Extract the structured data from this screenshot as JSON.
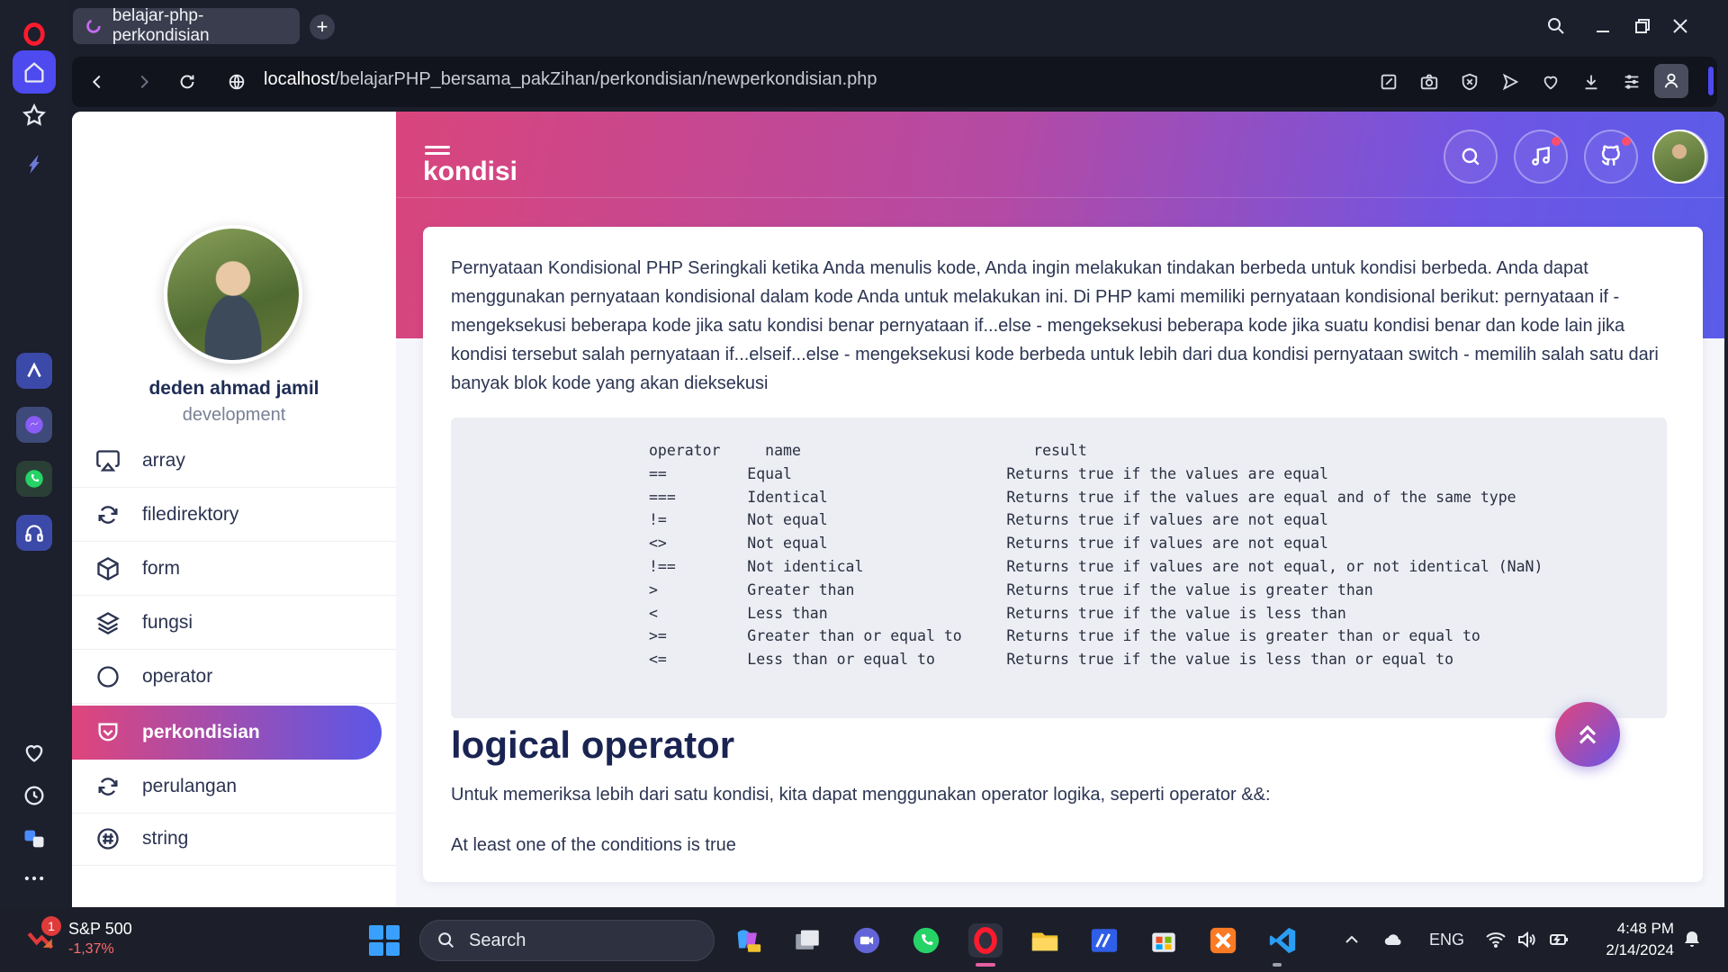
{
  "browser": {
    "tab_title": "belajar-php-perkondisian",
    "url_host": "localhost",
    "url_path": "/belajarPHP_bersama_pakZihan/perkondisian/newperkondisian.php"
  },
  "sidebar": {
    "user_name": "deden ahmad jamil",
    "user_role": "development",
    "items": [
      {
        "label": "array",
        "icon": "airplay-icon"
      },
      {
        "label": "filedirektory",
        "icon": "refresh-icon"
      },
      {
        "label": "form",
        "icon": "box-icon"
      },
      {
        "label": "fungsi",
        "icon": "layers-icon"
      },
      {
        "label": "operator",
        "icon": "circle-icon"
      },
      {
        "label": "perkondisian",
        "icon": "pocket-icon",
        "active": true
      },
      {
        "label": "perulangan",
        "icon": "refresh-icon"
      },
      {
        "label": "string",
        "icon": "hash-icon"
      }
    ]
  },
  "header": {
    "title": "kondisi"
  },
  "content": {
    "intro": "Pernyataan Kondisional PHP Seringkali ketika Anda menulis kode, Anda ingin melakukan tindakan berbeda untuk kondisi berbeda. Anda dapat menggunakan pernyataan kondisional dalam kode Anda untuk melakukan ini. Di PHP kami memiliki pernyataan kondisional berikut: pernyataan if - mengeksekusi beberapa kode jika satu kondisi benar pernyataan if...else - mengeksekusi beberapa kode jika suatu kondisi benar dan kode lain jika kondisi tersebut salah pernyataan if...elseif...else - mengeksekusi kode berbeda untuk lebih dari dua kondisi pernyataan switch - memilih salah satu dari banyak blok kode yang akan dieksekusi",
    "code_table": "operator     name                          result\n==         Equal                        Returns true if the values are equal\n===        Identical                    Returns true if the values are equal and of the same type\n!=         Not equal                    Returns true if values are not equal\n<>         Not equal                    Returns true if values are not equal\n!==        Not identical                Returns true if values are not equal, or not identical (NaN)\n>          Greater than                 Returns true if the value is greater than\n<          Less than                    Returns true if the value is less than\n>=         Greater than or equal to     Returns true if the value is greater than or equal to\n<=         Less than or equal to        Returns true if the value is less than or equal to",
    "heading": "logical operator",
    "paragraph1": "Untuk memeriksa lebih dari satu kondisi, kita dapat menggunakan operator logika, seperti operator &&:",
    "paragraph2": "At least one of the conditions is true"
  },
  "taskbar": {
    "ticker_badge": "1",
    "ticker_name": "S&P 500",
    "ticker_value": "-1,37%",
    "search_placeholder": "Search",
    "language": "ENG",
    "time": "4:48 PM",
    "date": "2/14/2024"
  },
  "colors": {
    "accent_start": "#e0457b",
    "accent_end": "#5b57e8",
    "browser_accent": "#4d4af0"
  }
}
